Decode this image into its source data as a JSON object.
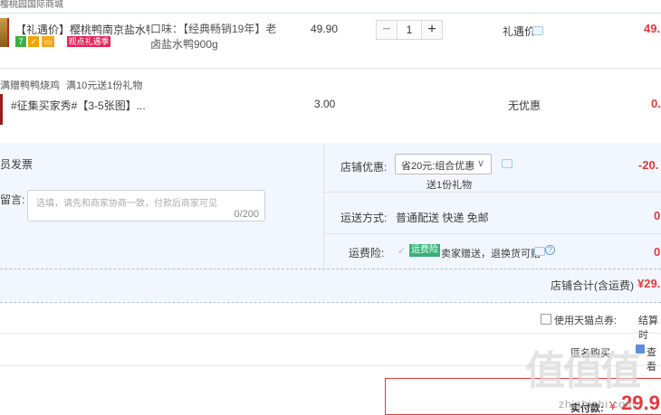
{
  "top_crumb": "樱桃园国际商城",
  "item1": {
    "title": "【礼遇价】樱桃鸭南京盐水鸭正...",
    "tag_label": "观点礼遇季",
    "sku": "口味：【经典畅销19年】老卤盐水鸭900g",
    "unit_price": "49.90",
    "quantity": "1",
    "promo": "礼遇价",
    "subtotal": "49."
  },
  "gift_header": {
    "prefix": "满赠鸭鸭烧鸡",
    "text": "满10元送1份礼物"
  },
  "item2": {
    "title": "#征集买家秀#【3-5张图】...",
    "unit_price": "3.00",
    "promo": "无优惠",
    "subtotal": "0."
  },
  "shipping": {
    "from_label": "员发票",
    "message_label": "留言:",
    "message_placeholder": "选填，请先和商家协商一致，付款后商家可见",
    "message_count": "0/200"
  },
  "shop_discount": {
    "label": "店铺优惠:",
    "selected": "省20元:组合优惠",
    "gift_note": "送1份礼物",
    "amount": "-20."
  },
  "delivery": {
    "label": "运送方式:",
    "value": "普通配送 快递 免邮",
    "amount": "0"
  },
  "insurance": {
    "label": "运费险:",
    "tag": "运费险",
    "value": "卖家赠送，退换货可赔",
    "amount": "0"
  },
  "shop_total": {
    "label": "店铺合计(含运费)",
    "amount": "¥29."
  },
  "coupon": {
    "label": "使用天猫点券:",
    "settle": "结算时"
  },
  "anon": {
    "label": "匿名购买",
    "checkbox_label": "查看"
  },
  "payment": {
    "label": "实付款:",
    "currency": "¥",
    "amount": "29.9"
  },
  "watermark": {
    "logo": "值值值",
    "site": "zhizhizhi.com"
  }
}
